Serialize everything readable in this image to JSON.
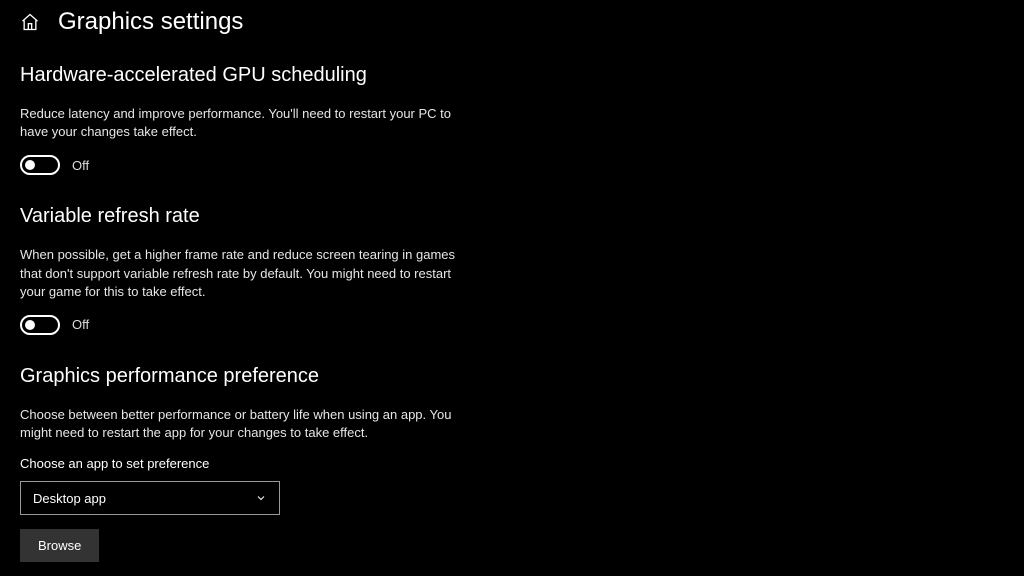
{
  "header": {
    "title": "Graphics settings"
  },
  "sections": {
    "gpu": {
      "heading": "Hardware-accelerated GPU scheduling",
      "desc": "Reduce latency and improve performance. You'll need to restart your PC to have your changes take effect.",
      "toggle_state": "Off"
    },
    "vrr": {
      "heading": "Variable refresh rate",
      "desc": "When possible, get a higher frame rate and reduce screen tearing in games that don't support variable refresh rate by default. You might need to restart your game for this to take effect.",
      "toggle_state": "Off"
    },
    "perf": {
      "heading": "Graphics performance preference",
      "desc": "Choose between better performance or battery life when using an app. You might need to restart the app for your changes to take effect.",
      "choose_label": "Choose an app to set preference",
      "dropdown_selected": "Desktop app",
      "browse_label": "Browse"
    }
  }
}
